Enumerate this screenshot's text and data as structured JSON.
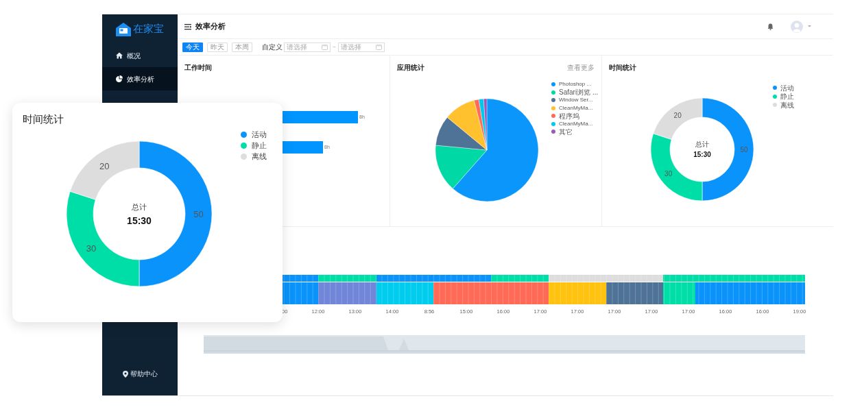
{
  "sidebar": {
    "logo": "在家宝",
    "items": [
      {
        "label": "概况",
        "selected": false
      },
      {
        "label": "效率分析",
        "selected": true
      }
    ],
    "help": "帮助中心"
  },
  "header": {
    "title": "效率分析"
  },
  "filters": {
    "ranges": [
      {
        "label": "今天",
        "selected": true
      },
      {
        "label": "昨天",
        "selected": false
      },
      {
        "label": "本周",
        "selected": false
      }
    ],
    "custom_label": "自定义",
    "date_fields": [
      {
        "placeholder": "请选择"
      },
      {
        "placeholder": "请选择"
      }
    ],
    "separator": "~"
  },
  "work_time": {
    "title": "工作时间",
    "bar_labels": [
      "8h",
      "8h"
    ]
  },
  "app_stats": {
    "title": "应用统计",
    "more_link": "查看更多",
    "legend": [
      {
        "label": "Photoshop ...",
        "color": "#0a96fa"
      },
      {
        "label": "Safari浏览 ...",
        "color": "#00d9a6"
      },
      {
        "label": "Window Ser...",
        "color": "#4e7397"
      },
      {
        "label": "CleanMyMa...",
        "color": "#ffc12e"
      },
      {
        "label": "程序坞",
        "color": "#ff6b57"
      },
      {
        "label": "CleanMyMa...",
        "color": "#00c8ec"
      },
      {
        "label": "其它",
        "color": "#9b59b6"
      }
    ]
  },
  "time_stats": {
    "title": "时间统计",
    "total_label": "总计",
    "total": "15:30",
    "chart_data": {
      "type": "donut",
      "categories": [
        "活动",
        "静止",
        "离线"
      ],
      "values": [
        50,
        30,
        20
      ],
      "colors": [
        "#0a93fb",
        "#00dea8",
        "#dddddd"
      ],
      "data_labels": true
    }
  },
  "timeline": {
    "top_segments": [
      {
        "color": "#0a93fb"
      },
      {
        "color": "#00dea8"
      },
      {
        "color": "#0a93fb"
      },
      {
        "color": "#00dea8"
      },
      {
        "color": "#dddddd"
      },
      {
        "color": "#00dea8"
      }
    ],
    "bottom_segments": [
      {
        "color": "#0a93fb"
      },
      {
        "color": "#7186d8"
      },
      {
        "color": "#00ccee"
      },
      {
        "color": "#ff6a56"
      },
      {
        "color": "#ffc20e"
      },
      {
        "color": "#4f7397"
      },
      {
        "color": "#00dea8"
      },
      {
        "color": "#0a93fb"
      }
    ],
    "axis_labels": [
      "00",
      "12:00",
      "13:00",
      "14:00",
      "8:56",
      "15:00",
      "16:00",
      "17:00",
      "17:00",
      "17:00",
      "17:00",
      "17:00",
      "16:00",
      "16:00",
      "19:00"
    ]
  },
  "floating_card": {
    "title": "时间统计",
    "total_label": "总计",
    "total": "15:30",
    "chart_data": {
      "type": "donut",
      "categories": [
        "活动",
        "静止",
        "离线"
      ],
      "values": [
        50,
        30,
        20
      ],
      "colors": [
        "#0a93fb",
        "#00dea8",
        "#dddddd"
      ],
      "data_labels": true
    }
  }
}
